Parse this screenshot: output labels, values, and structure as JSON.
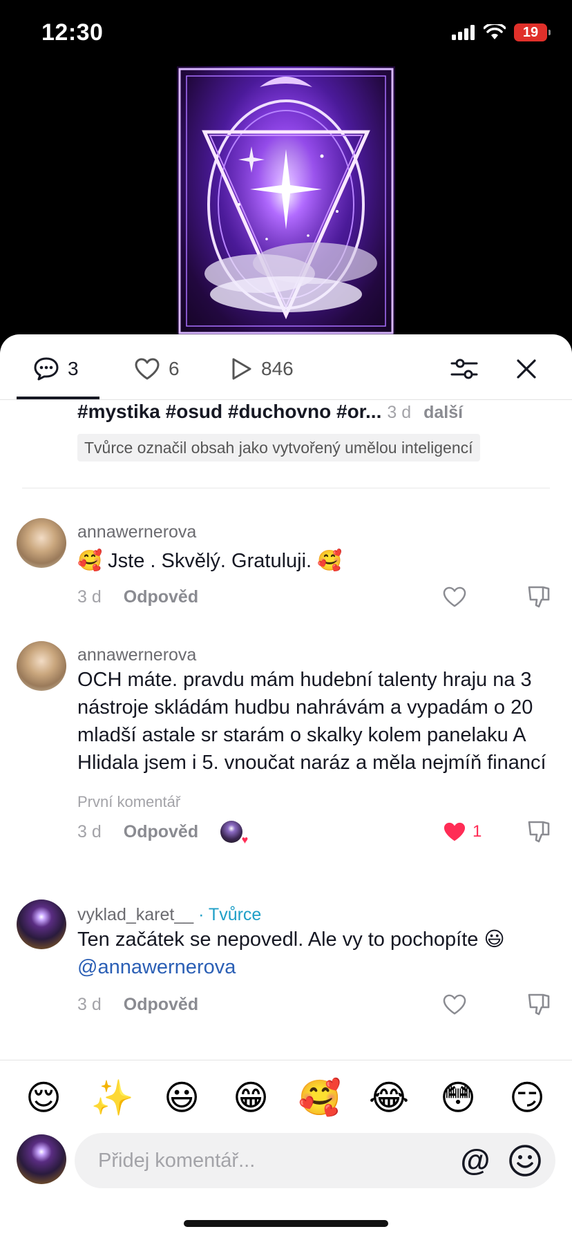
{
  "status_bar": {
    "time": "12:30",
    "battery": "19"
  },
  "tabs": {
    "comments_count": "3",
    "likes_count": "6",
    "views_count": "846"
  },
  "description": {
    "text": "#mystika #osud #duchovno #or...",
    "date": "3 d",
    "more_label": "další",
    "ai_label": "Tvůrce označil obsah jako vytvořený umělou inteligencí"
  },
  "comments": [
    {
      "username": "annawernerova",
      "text": "🥰 Jste . Skvělý. Gratuluji. 🥰",
      "date": "3 d",
      "reply_label": "Odpověd"
    },
    {
      "username": "annawernerova",
      "text": "OCH máte. pravdu mám hudební talenty hraju na 3 nástroje skládám hudbu nahrávám a vypadám o 20 mladší astale sr starám o skalky kolem panelaku A Hlidala jsem i 5. vnoučat naráz a měla nejmíň financí",
      "first_comment_label": "První komentář",
      "date": "3 d",
      "reply_label": "Odpověd",
      "like_count": "1"
    },
    {
      "username": "vyklad_karet__",
      "creator_label": "· Tvůrce",
      "text": "Ten začátek se nepovedl. Ale vy to pochopíte 😃",
      "mention": "@annawernerova",
      "date": "3 d",
      "reply_label": "Odpověd"
    }
  ],
  "emoji_bar": [
    "😌",
    "✨",
    "😃",
    "😁",
    "🥰",
    "😂",
    "😳",
    "😏"
  ],
  "input": {
    "placeholder": "Přidej komentář...",
    "at_symbol": "@"
  },
  "colors": {
    "accent_like": "#ff2c55",
    "creator_tag": "#1f9fc7",
    "mention": "#2b5fb5",
    "battery": "#e0302a"
  },
  "icons": [
    "comment-icon",
    "heart-icon",
    "play-icon",
    "filter-icon",
    "close-icon",
    "dislike-icon",
    "emoji-icon"
  ]
}
